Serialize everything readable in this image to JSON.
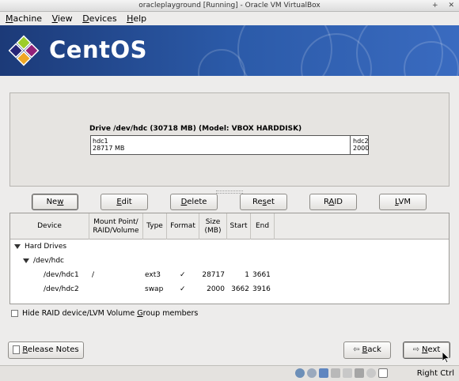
{
  "window": {
    "title": "oracleplayground [Running] - Oracle VM VirtualBox",
    "controls": [
      "+",
      "✕"
    ]
  },
  "menu": [
    {
      "key": "M",
      "rest": "achine"
    },
    {
      "key": "V",
      "rest": "iew"
    },
    {
      "key": "D",
      "rest": "evices"
    },
    {
      "key": "H",
      "rest": "elp"
    }
  ],
  "banner": {
    "product": "CentOS"
  },
  "drive": {
    "title": "Drive /dev/hdc (30718 MB) (Model: VBOX HARDDISK)",
    "partitions": [
      {
        "name": "hdc1",
        "size": "28717 MB"
      },
      {
        "name": "hdc2",
        "size": "2000"
      }
    ]
  },
  "buttons": {
    "new": {
      "key": "w",
      "pre": "Ne",
      "post": ""
    },
    "edit": {
      "key": "E",
      "pre": "",
      "post": "dit"
    },
    "delete": {
      "key": "D",
      "pre": "",
      "post": "elete"
    },
    "reset": {
      "key": "s",
      "pre": "Re",
      "post": "et"
    },
    "raid": {
      "key": "A",
      "pre": "R",
      "post": "ID"
    },
    "lvm": {
      "key": "L",
      "pre": "",
      "post": "VM"
    }
  },
  "table": {
    "headers": {
      "device": "Device",
      "mount_line1": "Mount Point/",
      "mount_line2": "RAID/Volume",
      "type": "Type",
      "format": "Format",
      "size_line1": "Size",
      "size_line2": "(MB)",
      "start": "Start",
      "end": "End"
    },
    "group": "Hard Drives",
    "disk": "/dev/hdc",
    "rows": [
      {
        "device": "/dev/hdc1",
        "mount": "/",
        "type": "ext3",
        "format": "✓",
        "size": "28717",
        "start": "1",
        "end": "3661"
      },
      {
        "device": "/dev/hdc2",
        "mount": "",
        "type": "swap",
        "format": "✓",
        "size": "2000",
        "start": "3662",
        "end": "3916"
      }
    ]
  },
  "hide_option": {
    "pre": "Hide RAID device/LVM Volume ",
    "key": "G",
    "post": "roup members",
    "checked": false
  },
  "nav": {
    "release_notes": {
      "key": "R",
      "post": "elease Notes"
    },
    "back": {
      "key": "B",
      "post": "ack"
    },
    "next": {
      "key": "N",
      "post": "ext"
    }
  },
  "statusbar": {
    "host_key": "Right Ctrl"
  },
  "colors": {
    "banner": "#2b5aa8",
    "panel": "#e6e4e1"
  }
}
